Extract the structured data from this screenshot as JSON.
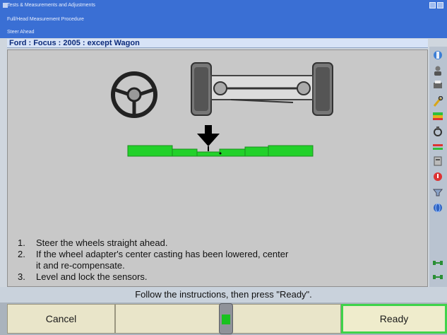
{
  "window": {
    "title": "Tests & Measurements and Adjustments",
    "subtitle": "Full/Head Measurement Procedure",
    "step": "Steer Ahead"
  },
  "vehicle": {
    "label": "Ford : Focus : 2005 : except Wagon"
  },
  "instructions": [
    {
      "num": "1.",
      "text": "Steer the wheels straight ahead."
    },
    {
      "num": "2.",
      "text": "If the wheel adapter's center casting has been lowered, center it and re-compensate."
    },
    {
      "num": "3.",
      "text": "Level and lock the sensors."
    }
  ],
  "status": {
    "message": "Follow the instructions, then press \"Ready\"."
  },
  "buttons": {
    "cancel": "Cancel",
    "ready": "Ready"
  },
  "gauge": {
    "level": 0.5
  },
  "colors": {
    "titlebar": "#3a6fd4",
    "indicator_green": "#22d12a",
    "ready_border": "#3fd34a",
    "background": "#c8c8c8"
  },
  "sidebar_icons": [
    "tools-icon",
    "user-icon",
    "print-icon",
    "wrench-icon",
    "flag-icon",
    "clamp-icon",
    "settings-icon",
    "help-icon",
    "warning-icon",
    "filter-icon",
    "globe-icon",
    "link-icon",
    "link-icon"
  ]
}
